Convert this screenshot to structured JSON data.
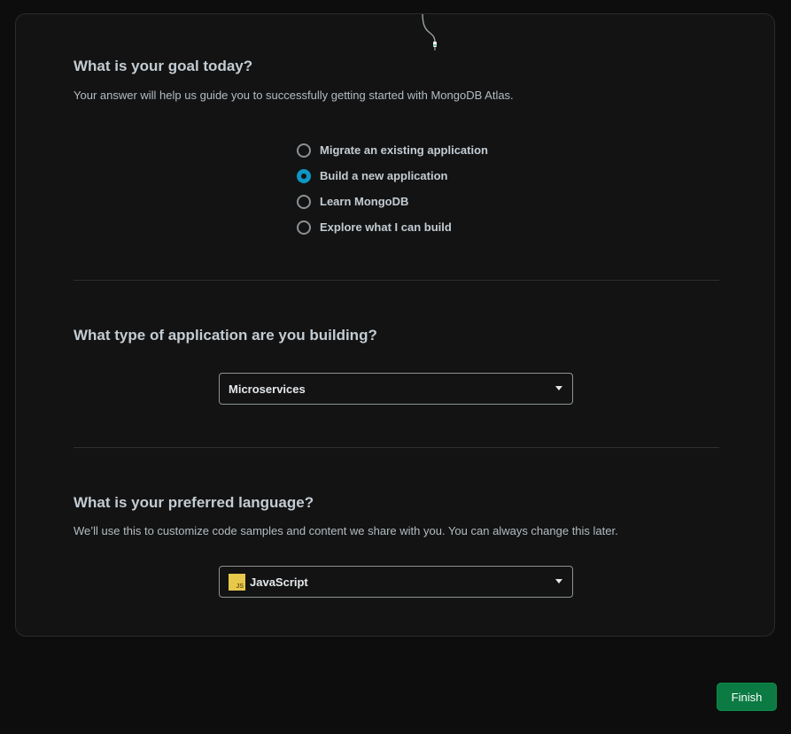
{
  "goal": {
    "title": "What is your goal today?",
    "description": "Your answer will help us guide you to successfully getting started with MongoDB Atlas.",
    "options": [
      {
        "label": "Migrate an existing application",
        "selected": false
      },
      {
        "label": "Build a new application",
        "selected": true
      },
      {
        "label": "Learn MongoDB",
        "selected": false
      },
      {
        "label": "Explore what I can build",
        "selected": false
      }
    ]
  },
  "app_type": {
    "title": "What type of application are you building?",
    "selected": "Microservices"
  },
  "language": {
    "title": "What is your preferred language?",
    "description": "We’ll use this to customize code samples and content we share with you. You can always change this later.",
    "selected": "JavaScript",
    "icon": "javascript-logo-icon",
    "icon_text": "JS"
  },
  "footer": {
    "finish_label": "Finish"
  },
  "colors": {
    "background": "#0d0d0d",
    "card": "#131313",
    "accent_radio": "#0e96c4",
    "finish_button": "#0b7a43",
    "js_badge": "#e7c84b"
  }
}
